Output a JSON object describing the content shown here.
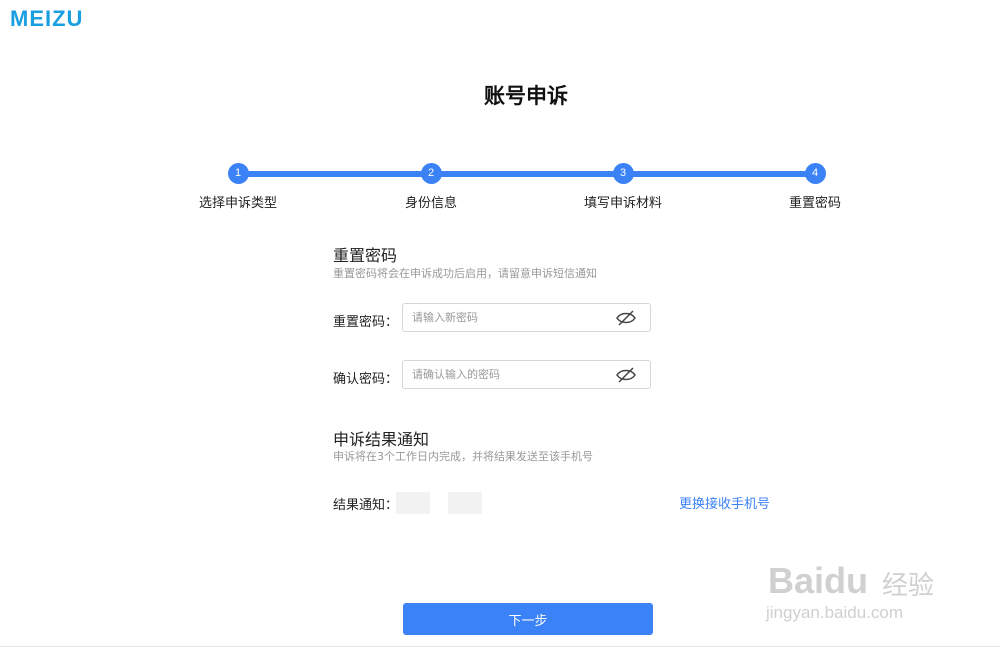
{
  "brand": {
    "logo": "MEIZU",
    "color": "#1a9fe0"
  },
  "page": {
    "title": "账号申诉"
  },
  "steps": [
    {
      "num": "1",
      "label": "选择申诉类型"
    },
    {
      "num": "2",
      "label": "身份信息"
    },
    {
      "num": "3",
      "label": "填写申诉材料"
    },
    {
      "num": "4",
      "label": "重置密码"
    }
  ],
  "reset_section": {
    "title": "重置密码",
    "desc": "重置密码将会在申诉成功后启用，请留意申诉短信通知"
  },
  "fields": {
    "new_password": {
      "label": "重置密码：",
      "placeholder": "请输入新密码",
      "value": ""
    },
    "confirm_password": {
      "label": "确认密码：",
      "placeholder": "请确认输入的密码",
      "value": ""
    }
  },
  "notify_section": {
    "title": "申诉结果通知",
    "desc": "申诉将在3个工作日内完成，并将结果发送至该手机号"
  },
  "result": {
    "label": "结果通知：",
    "change_link": "更换接收手机号"
  },
  "actions": {
    "next": "下一步"
  },
  "watermark": {
    "main": "Baidu",
    "cn": "经验",
    "sub": "jingyan.baidu.com"
  },
  "colors": {
    "accent": "#3b82f6",
    "muted": "#999999"
  },
  "icons": {
    "password_toggle": "eye-slash-icon"
  }
}
